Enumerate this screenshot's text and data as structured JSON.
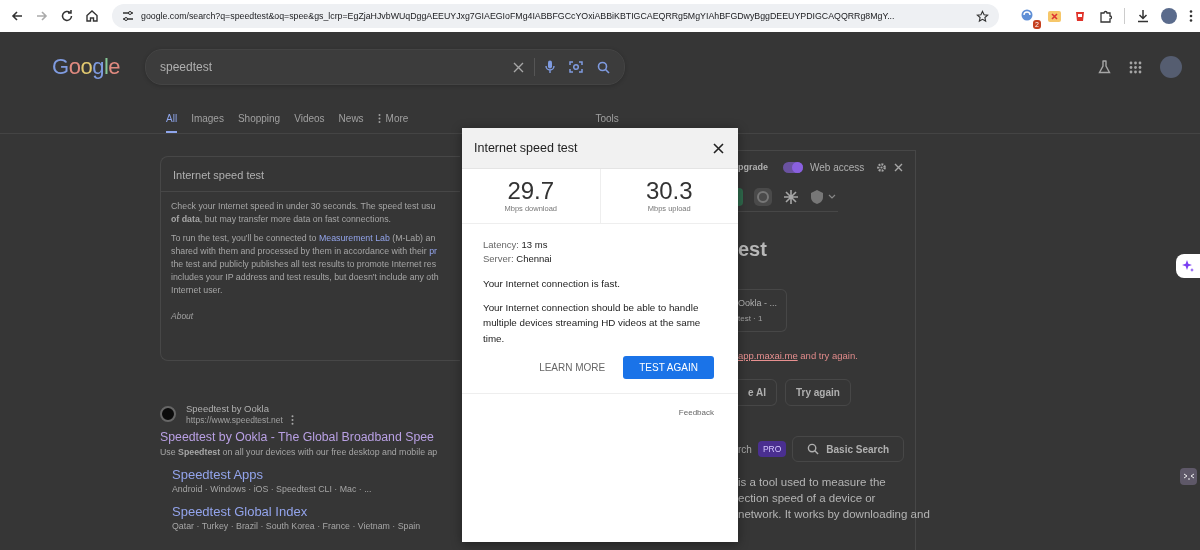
{
  "browser": {
    "url": "google.com/search?q=speedtest&oq=spee&gs_lcrp=EgZjaHJvbWUqDggAEEUYJxg7GIAEGIoFMg4IABBFGCcYOxiABBiKBTIGCAEQRRg5MgYIAhBFGDwyBggDEEUYPDIGCAQQRRg8MgY...",
    "extension_badge": "2"
  },
  "header": {
    "logo": "Google",
    "query": "speedtest"
  },
  "tabs": [
    {
      "label": "All",
      "selected": true,
      "kind": "tab"
    },
    {
      "label": "Images",
      "selected": false,
      "kind": "tab"
    },
    {
      "label": "Shopping",
      "selected": false,
      "kind": "tab"
    },
    {
      "label": "Videos",
      "selected": false,
      "kind": "tab"
    },
    {
      "label": "News",
      "selected": false,
      "kind": "tab"
    },
    {
      "label": "More",
      "selected": false,
      "kind": "menu"
    }
  ],
  "tools": "Tools",
  "info_card": {
    "title": "Internet speed test",
    "paragraphs": [
      [
        [
          {
            "text": "Check your Internet speed in under 30 seconds. The speed test usu",
            "kind": "text"
          }
        ],
        [
          {
            "text": "of data",
            "kind": "bold"
          },
          {
            "text": ", but may transfer more data on fast connections.",
            "kind": "text"
          }
        ]
      ],
      [
        [
          {
            "text": "To run the test, you'll be connected to ",
            "kind": "text"
          },
          {
            "text": "Measurement Lab",
            "kind": "link"
          },
          {
            "text": " (M-Lab) an",
            "kind": "text"
          }
        ],
        [
          {
            "text": "shared with them and processed by them in accordance with their ",
            "kind": "text"
          },
          {
            "text": "pr",
            "kind": "link"
          }
        ],
        [
          {
            "text": "the test and publicly publishes all test results to promote Internet res",
            "kind": "text"
          }
        ],
        [
          {
            "text": "includes your IP address and test results, but doesn't include any oth",
            "kind": "text"
          }
        ],
        [
          {
            "text": "Internet user.",
            "kind": "text"
          }
        ]
      ]
    ],
    "about": "About"
  },
  "result": {
    "site": "Speedtest by Ookla",
    "url": "https://www.speedtest.net",
    "title": "Speedtest by Ookla - The Global Broadband Spee",
    "snippet": "Use **Speedtest** on all your devices with our free desktop and mobile ap",
    "sitelinks": [
      {
        "title": "Speedtest Apps",
        "snippet": "Android · Windows · iOS · Speedtest CLI · Mac · ..."
      },
      {
        "title": "Speedtest Global Index",
        "snippet": "Qatar · Turkey · Brazil · South Korea · France · Vietnam · Spain"
      }
    ]
  },
  "side_panel": {
    "upgrade": "pgrade",
    "web_access": {
      "label": "Web access",
      "on": true
    },
    "heading": "est",
    "source_card": {
      "title": "Ookla - ...",
      "meta": "test · 1"
    },
    "error": {
      "link": "app.maxai.me",
      "text": " and try again."
    },
    "buttons": [
      "e AI",
      "Try again"
    ],
    "search_modes": {
      "cut": "rch",
      "badge": "PRO",
      "basic": "Basic Search"
    },
    "answer_lines": [
      "is a tool used to measure the",
      "ection speed of a device or",
      "network. It works by downloading and"
    ]
  },
  "dialog": {
    "title": "Internet speed test",
    "stats": [
      {
        "value": "29.7",
        "unit": "Mbps download"
      },
      {
        "value": "30.3",
        "unit": "Mbps upload"
      }
    ],
    "details": [
      {
        "label": "Latency:",
        "value": "13 ms"
      },
      {
        "label": "Server:",
        "value": "Chennai"
      }
    ],
    "summary": "Your Internet connection is fast.",
    "description": "Your Internet connection should be able to handle multiple devices streaming HD videos at the same time.",
    "buttons": [
      {
        "label": "LEARN MORE",
        "kind": "text"
      },
      {
        "label": "TEST AGAIN",
        "kind": "primary"
      }
    ],
    "feedback": "Feedback"
  }
}
